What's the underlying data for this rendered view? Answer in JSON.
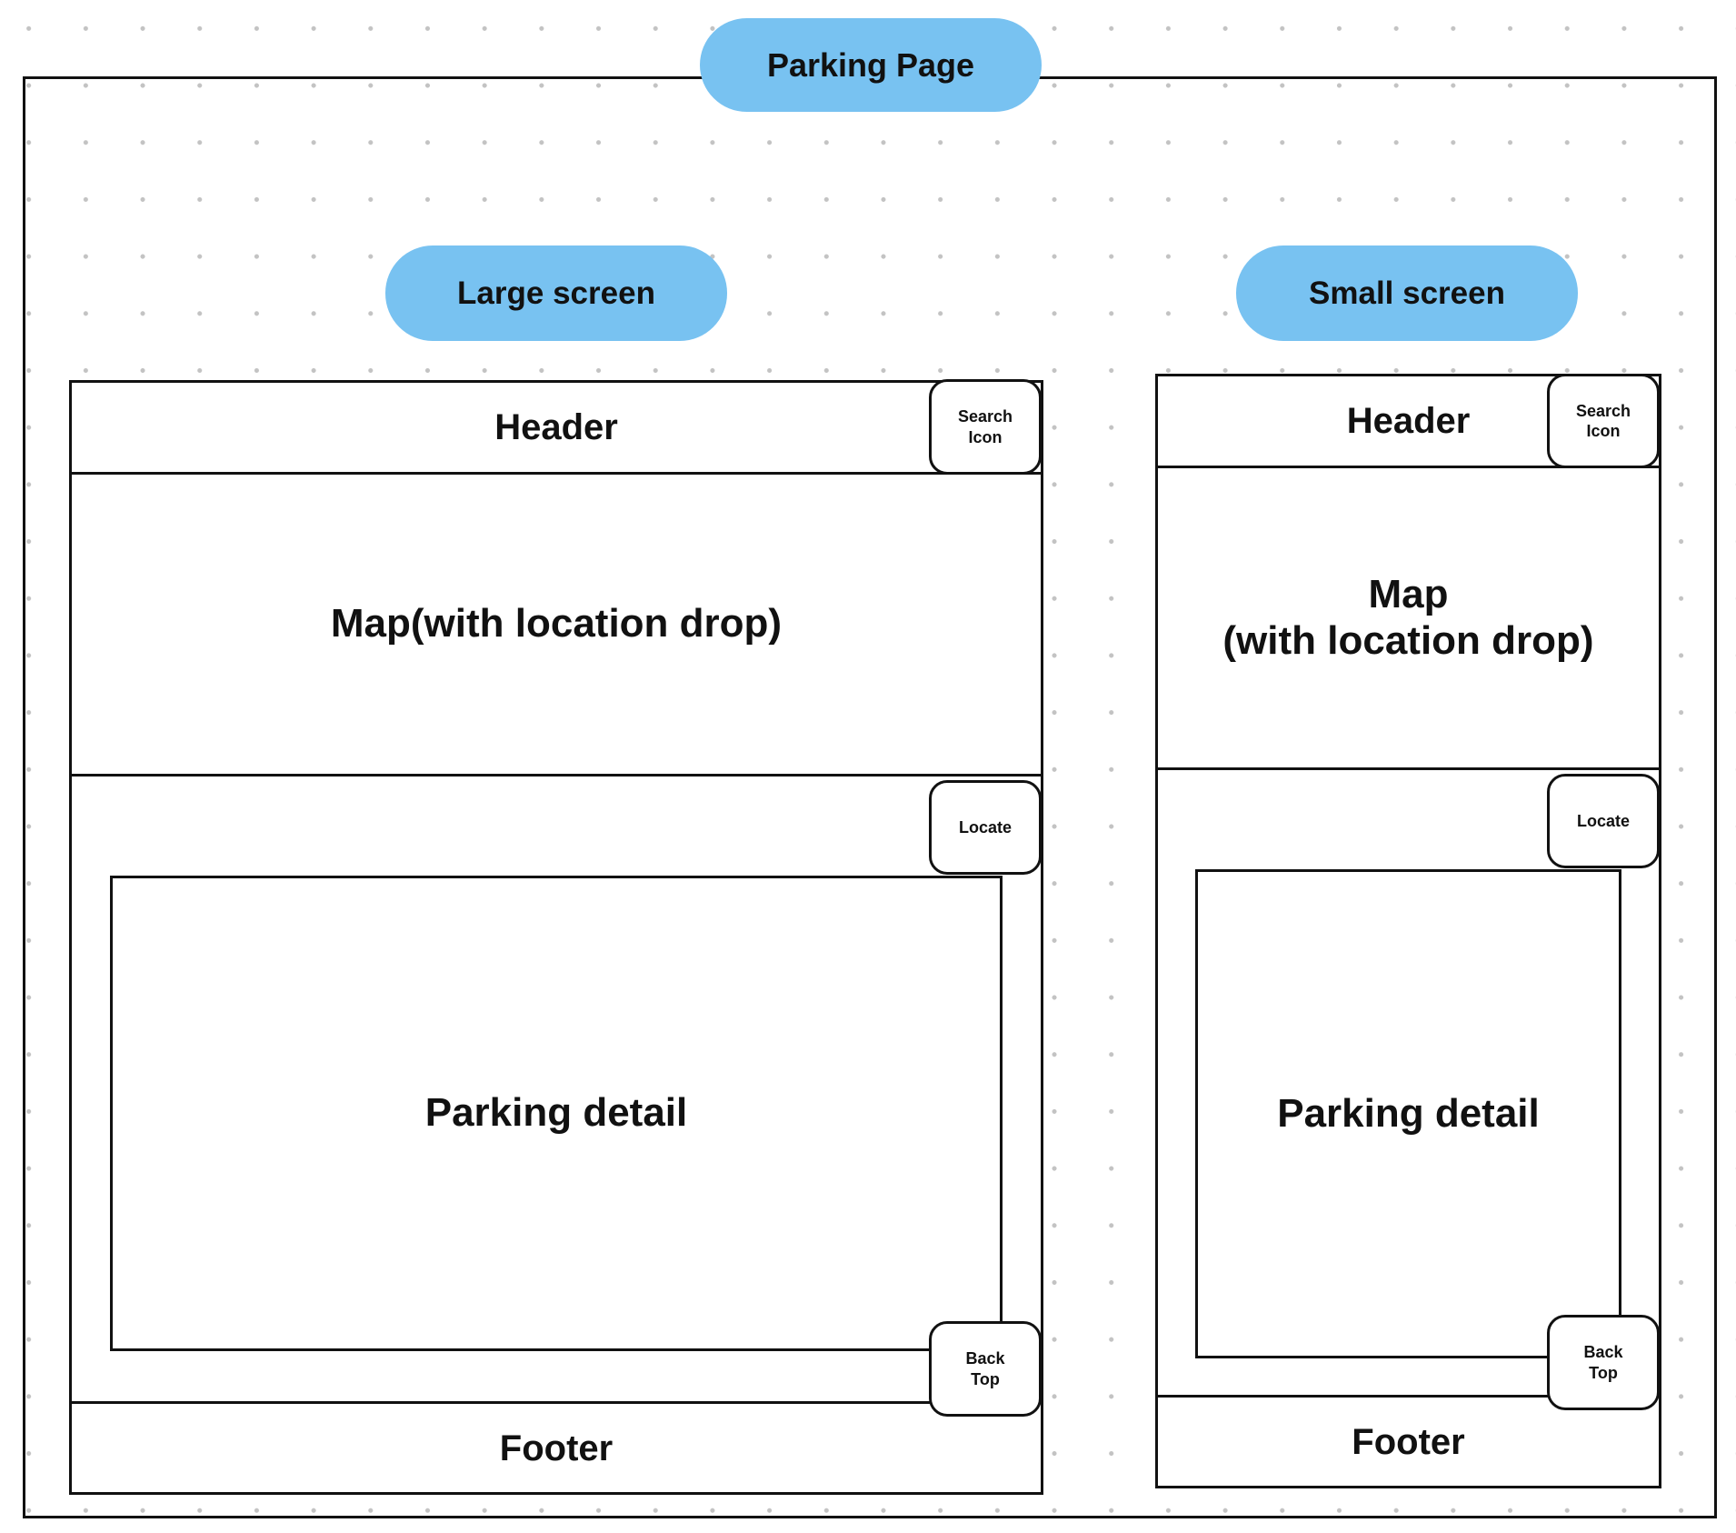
{
  "title": "Parking Page",
  "colors": {
    "pill": "#78c2f1",
    "stroke": "#111111",
    "grid_dot": "#c3c3c3"
  },
  "large_screen": {
    "label": "Large screen",
    "header": "Header",
    "search_icon": "Search\nIcon",
    "map": "Map(with location drop)",
    "locate": "Locate",
    "parking_detail": "Parking detail",
    "back_top": "Back\nTop",
    "footer": "Footer"
  },
  "small_screen": {
    "label": "Small screen",
    "header": "Header",
    "search_icon": "Search\nIcon",
    "map": "Map\n(with location drop)",
    "locate": "Locate",
    "parking_detail": "Parking detail",
    "back_top": "Back\nTop",
    "footer": "Footer"
  }
}
